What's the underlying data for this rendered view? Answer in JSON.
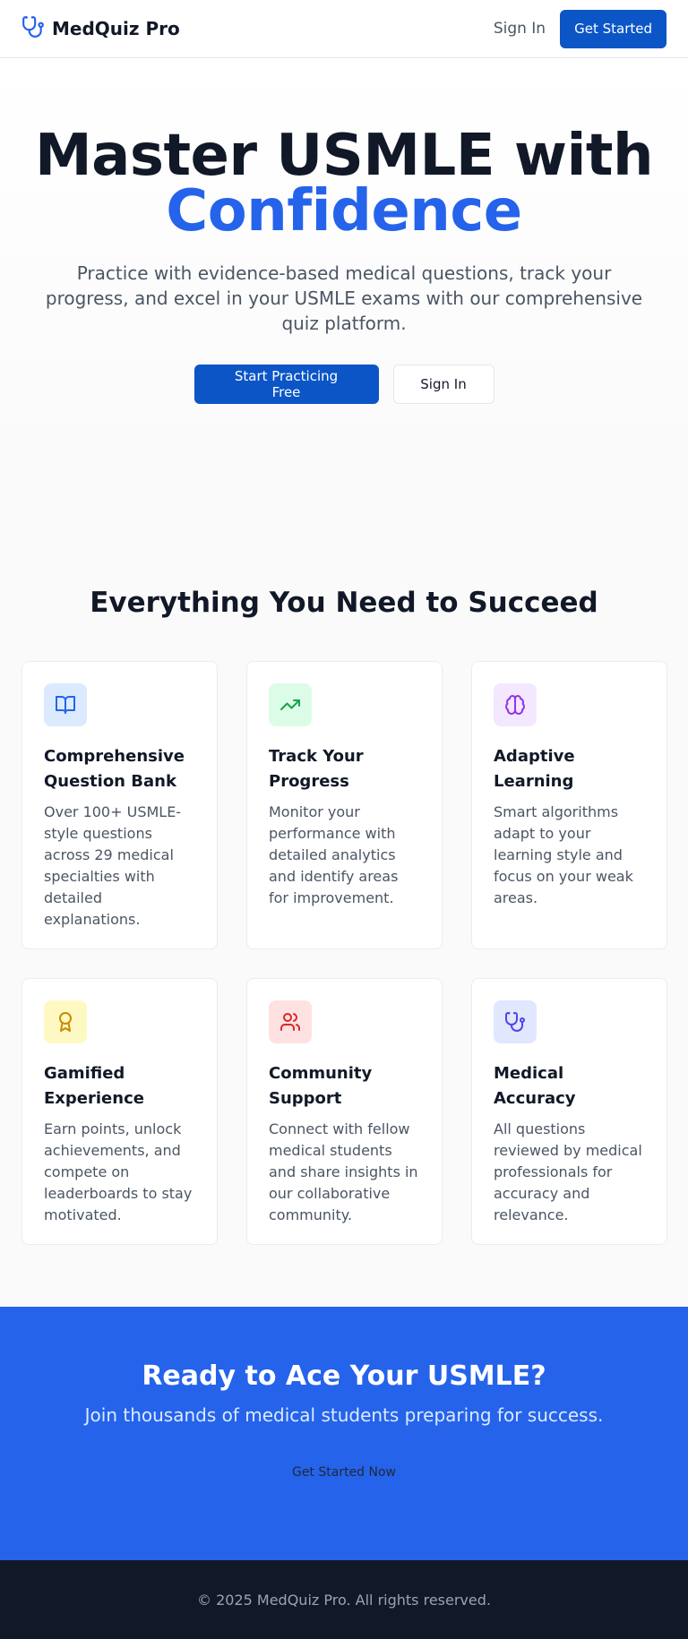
{
  "header": {
    "brand": "MedQuiz Pro",
    "brand_icon": "stethoscope-icon",
    "sign_in": "Sign In",
    "get_started": "Get Started"
  },
  "hero": {
    "title_line1": "Master USMLE with",
    "title_line2": "Confidence",
    "subtitle": "Practice with evidence-based medical questions, track your progress, and excel in your USMLE exams with our comprehensive quiz platform.",
    "primary_button": "Start Practicing Free",
    "secondary_button": "Sign In"
  },
  "features": {
    "title": "Everything You Need to Succeed",
    "items": [
      {
        "icon": "book-open-icon",
        "icon_color": "#2563eb",
        "icon_bg": "#dbeafe",
        "title": "Comprehensive Question Bank",
        "desc": "Over 100+ USMLE-style questions across 29 medical specialties with detailed explanations."
      },
      {
        "icon": "trending-up-icon",
        "icon_color": "#16a34a",
        "icon_bg": "#dcfce7",
        "title": "Track Your Progress",
        "desc": "Monitor your performance with detailed analytics and identify areas for improvement."
      },
      {
        "icon": "brain-icon",
        "icon_color": "#9333ea",
        "icon_bg": "#f3e8ff",
        "title": "Adaptive Learning",
        "desc": "Smart algorithms adapt to your learning style and focus on your weak areas."
      },
      {
        "icon": "award-icon",
        "icon_color": "#ca8a04",
        "icon_bg": "#fef9c3",
        "title": "Gamified Experience",
        "desc": "Earn points, unlock achievements, and compete on leaderboards to stay motivated."
      },
      {
        "icon": "users-icon",
        "icon_color": "#dc2626",
        "icon_bg": "#fee2e2",
        "title": "Community Support",
        "desc": "Connect with fellow medical students and share insights in our collaborative community."
      },
      {
        "icon": "stethoscope-icon",
        "icon_color": "#4f46e5",
        "icon_bg": "#e0e7ff",
        "title": "Medical Accuracy",
        "desc": "All questions reviewed by medical professionals for accuracy and relevance."
      }
    ]
  },
  "cta": {
    "title": "Ready to Ace Your USMLE?",
    "subtitle": "Join thousands of medical students preparing for success.",
    "button": "Get Started Now"
  },
  "footer": {
    "copyright": "© 2025 MedQuiz Pro. All rights reserved."
  },
  "colors": {
    "brand_primary": "#0b55c6",
    "accent": "#2563eb",
    "footer_bg": "#111827"
  }
}
